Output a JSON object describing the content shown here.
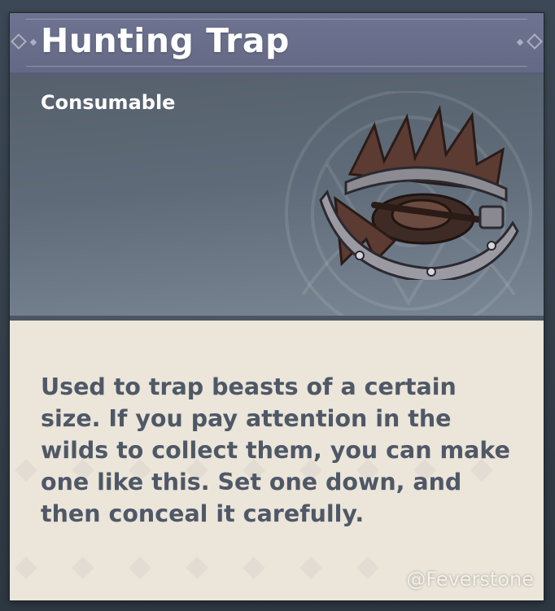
{
  "item": {
    "name": "Hunting Trap",
    "type": "Consumable",
    "description": "Used to trap beasts of a certain size. If you pay attention in the wilds to collect them, you can make one like this. Set one down, and then conceal it carefully.",
    "icon": "hunting-trap-icon"
  },
  "watermark": "@Feverstone",
  "colors": {
    "title_bar": "#6e7391",
    "hero_background": "#5f6b78",
    "description_background": "#ebe5da",
    "description_text": "#4f5866"
  }
}
